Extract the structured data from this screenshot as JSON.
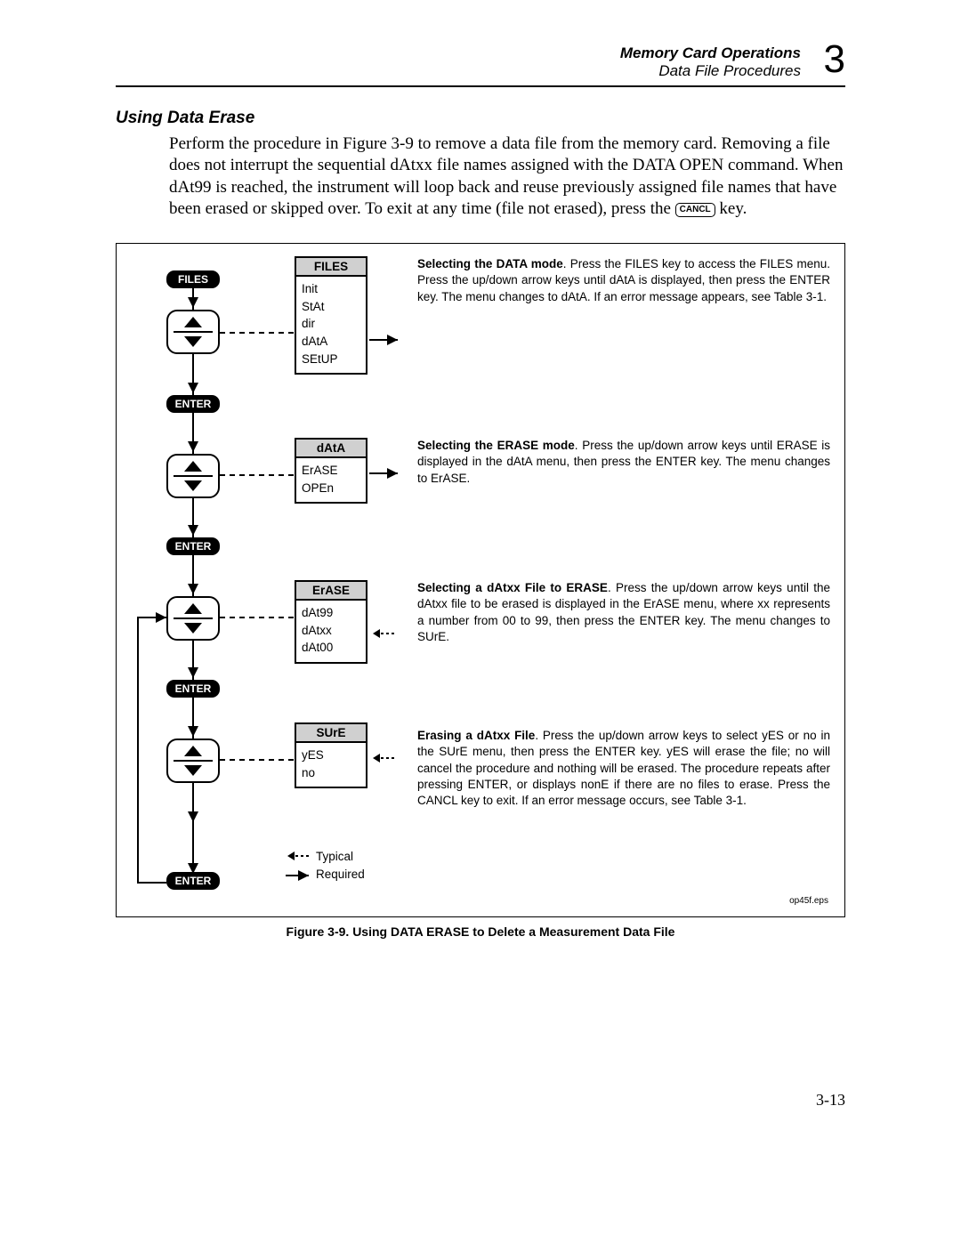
{
  "header": {
    "title": "Memory Card Operations",
    "subtitle": "Data File Procedures",
    "chapter": "3"
  },
  "section": {
    "heading": "Using Data Erase"
  },
  "paragraph": {
    "p1a": "Perform the procedure in Figure 3-9 to remove a data file from the memory card. Removing a file does not interrupt the sequential dAtxx file names assigned with the DATA OPEN command. When dAt99 is reached, the instrument will loop back and reuse previously assigned file names that have been erased or skipped over. To exit at any time (file not erased), press the ",
    "cancl": "CANCL",
    "p1b": " key."
  },
  "keys": {
    "files": "FILES",
    "enter": "ENTER"
  },
  "menus": {
    "files": {
      "title": "FILES",
      "items": [
        "Init",
        "StAt",
        "dir",
        "dAtA",
        "SEtUP"
      ]
    },
    "data": {
      "title": "dAtA",
      "items": [
        "ErASE",
        "OPEn"
      ]
    },
    "erase": {
      "title": "ErASE",
      "items": [
        "dAt99",
        "dAtxx",
        "dAt00"
      ]
    },
    "sure": {
      "title": "SUrE",
      "items": [
        "yES",
        "no"
      ]
    }
  },
  "steps": {
    "s1": {
      "lead": "Selecting the DATA mode",
      "text": ".  Press the FILES key to access the FILES menu.  Press the up/down arrow keys until dAtA is displayed, then press the ENTER key.  The menu changes to dAtA.  If an error message appears, see Table 3-1."
    },
    "s2": {
      "lead": "Selecting the ERASE mode",
      "text": ".   Press the up/down arrow keys until ERASE is displayed in the dAtA menu, then press the ENTER key.  The menu changes to ErASE."
    },
    "s3": {
      "lead": "Selecting a dAtxx File to ERASE",
      "text": ".  Press the up/down arrow keys until the dAtxx file to be erased is displayed in the ErASE menu, where xx represents a number from 00 to 99, then press the ENTER key.  The menu changes to SUrE."
    },
    "s4": {
      "lead": "Erasing a dAtxx File",
      "text": ".  Press the up/down arrow keys to select yES or no in the SUrE menu, then press the ENTER key.  yES will erase the file; no will cancel the procedure and nothing will be erased.  The procedure repeats after pressing ENTER, or displays nonE if there are no files to erase.  Press the CANCL key to exit.  If an error message occurs, see Table 3-1."
    }
  },
  "legend": {
    "typical": "Typical",
    "required": "Required"
  },
  "figure": {
    "eps": "op45f.eps",
    "caption": "Figure 3-9. Using DATA ERASE to Delete a Measurement Data File"
  },
  "page_number": "3-13"
}
